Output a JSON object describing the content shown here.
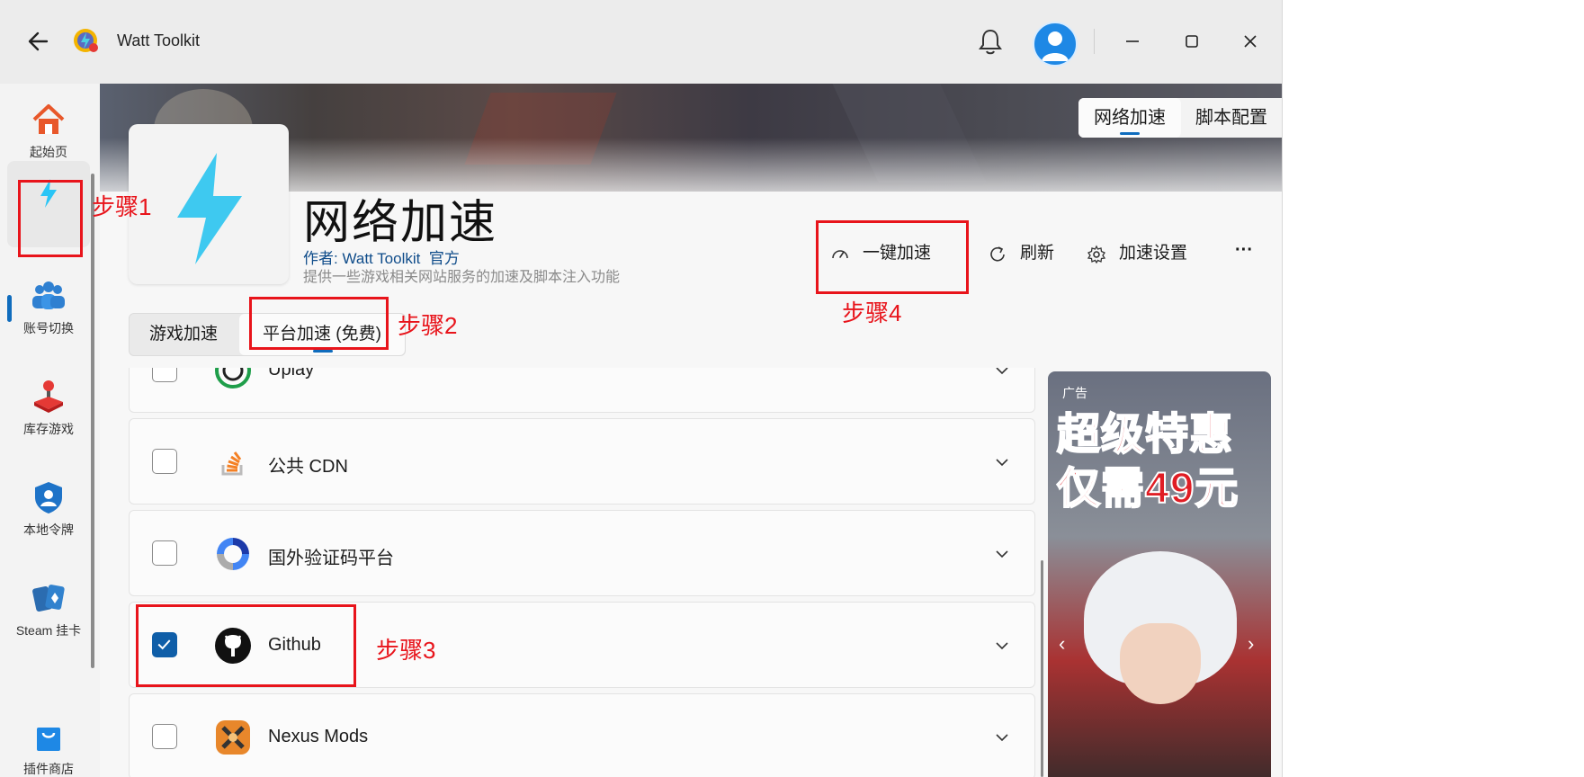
{
  "app": {
    "title": "Watt Toolkit"
  },
  "colors": {
    "accent": "#0f6cbd",
    "annotation": "#e8141b"
  },
  "sidebar": {
    "items": [
      {
        "label": "起始页",
        "icon": "home-icon"
      },
      {
        "label": "",
        "icon": "lightning-icon"
      },
      {
        "label": "账号切换",
        "icon": "users-icon"
      },
      {
        "label": "库存游戏",
        "icon": "joystick-icon"
      },
      {
        "label": "本地令牌",
        "icon": "shield-user-icon"
      },
      {
        "label": "Steam 挂卡",
        "icon": "cards-icon"
      },
      {
        "label": "插件商店",
        "icon": "shopping-bag-icon"
      }
    ]
  },
  "view_tabs": [
    "网络加速",
    "脚本配置"
  ],
  "plugin": {
    "title": "网络加速",
    "author_prefix": "作者: ",
    "author": "Watt Toolkit",
    "author_badge": "官方",
    "description": "提供一些游戏相关网站服务的加速及脚本注入功能"
  },
  "actions": {
    "one_click": "一键加速",
    "refresh": "刷新",
    "settings": "加速设置",
    "more": "···"
  },
  "sub_tabs": [
    "游戏加速",
    "平台加速 (免费)"
  ],
  "services": [
    {
      "name": "Uplay",
      "checked": false,
      "icon": "uplay-icon"
    },
    {
      "name": "公共 CDN",
      "checked": false,
      "icon": "stack-overflow-icon"
    },
    {
      "name": "国外验证码平台",
      "checked": false,
      "icon": "recaptcha-icon"
    },
    {
      "name": "Github",
      "checked": true,
      "icon": "github-icon"
    },
    {
      "name": "Nexus Mods",
      "checked": false,
      "icon": "nexus-mods-icon"
    }
  ],
  "ad": {
    "label": "广告",
    "line1": "超级特惠",
    "line2": "仅需49元",
    "prev": "‹",
    "next": "›"
  },
  "annotations": {
    "step1": "步骤1",
    "step2": "步骤2",
    "step3": "步骤3",
    "step4": "步骤4"
  }
}
